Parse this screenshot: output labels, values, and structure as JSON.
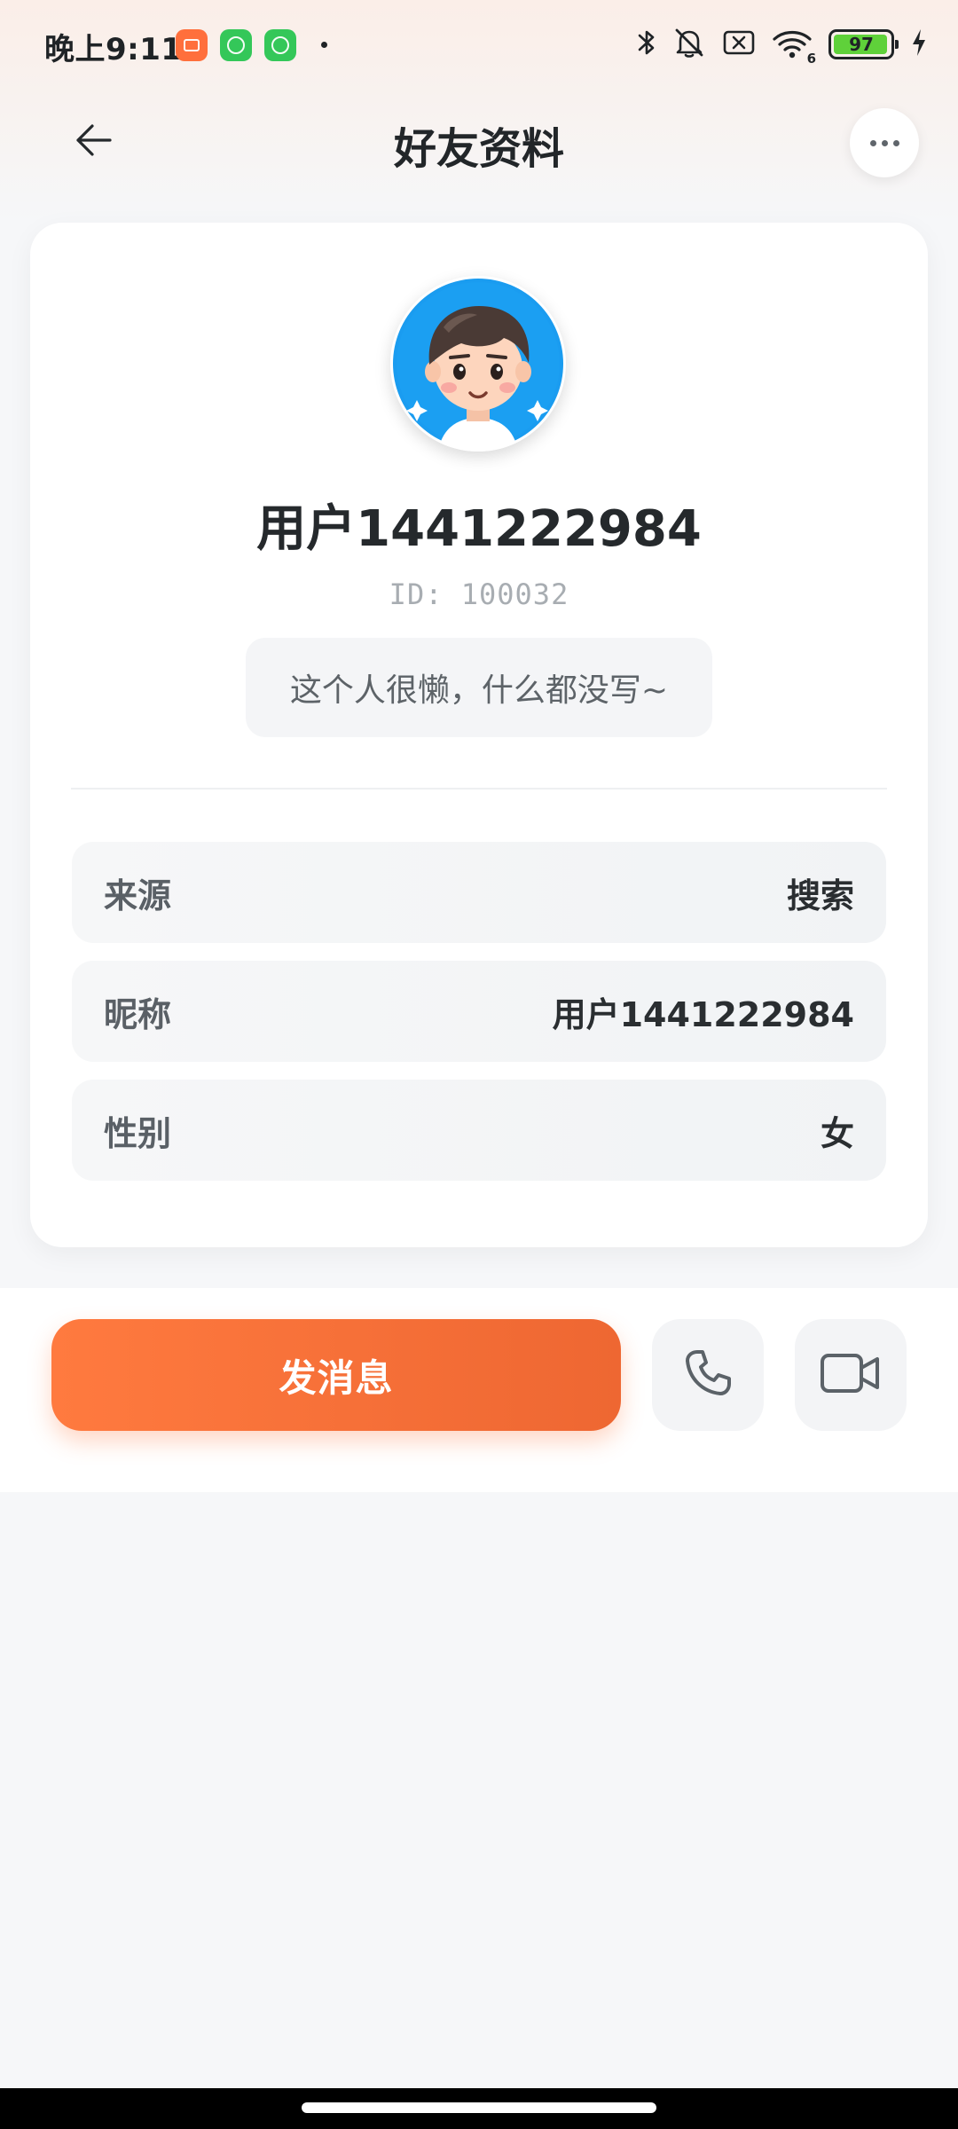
{
  "status_bar": {
    "time": "晚上9:11",
    "battery_level": "97",
    "battery_fraction": 0.97,
    "wifi_badge": "6",
    "icons": [
      "orange-app-icon",
      "green-app-icon",
      "green-app-icon",
      "bluetooth-icon",
      "mute-bell-icon",
      "sim-off-icon",
      "wifi-icon",
      "battery-icon",
      "charging-bolt-icon"
    ],
    "colors": {
      "battery_fill": "#5fd13a",
      "app_orange": "#ff6f3c",
      "app_green": "#34c759"
    }
  },
  "header": {
    "title": "好友资料",
    "back_icon": "arrow-left-icon",
    "more_icon": "more-dots-icon"
  },
  "profile": {
    "username": "用户1441222984",
    "id_label": "ID: 100032",
    "bio": "这个人很懒，什么都没写~",
    "avatar_icon": "cartoon-avatar"
  },
  "info_rows": [
    {
      "label": "来源",
      "value": "搜索"
    },
    {
      "label": "昵称",
      "value": "用户1441222984"
    },
    {
      "label": "性别",
      "value": "女"
    }
  ],
  "actions": {
    "send_message_label": "发消息",
    "call_icon": "phone-icon",
    "video_icon": "video-camera-icon",
    "accent_color": "#f26c35"
  }
}
